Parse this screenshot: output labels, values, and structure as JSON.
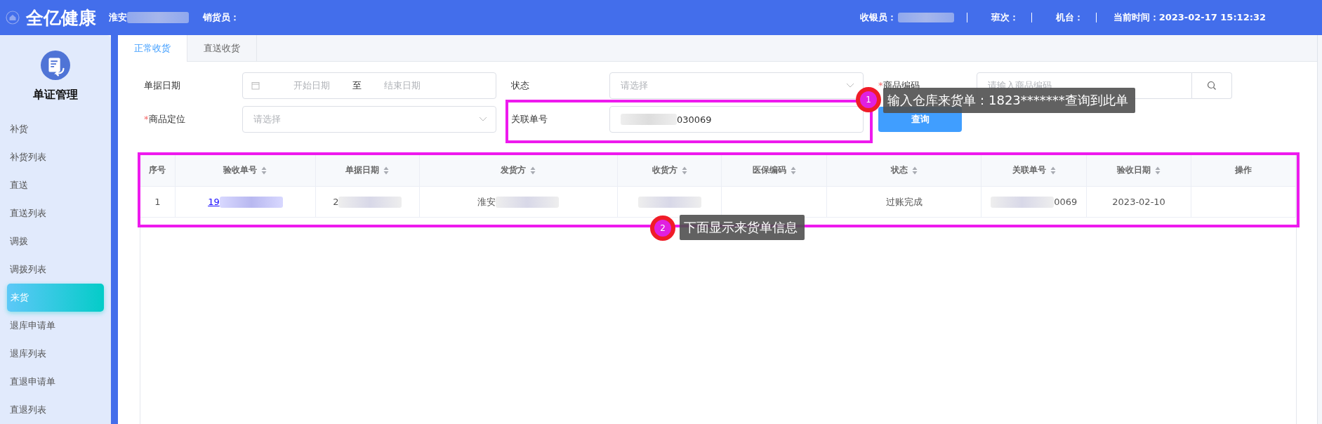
{
  "header": {
    "brand": "全亿健康",
    "store": "淮安",
    "salesperson_label": "销货员：",
    "cashier_label": "收银员：",
    "shift_label": "班次：",
    "terminal_label": "机台：",
    "time": "当前时间：2023-02-17 15:12:32"
  },
  "sidebar": {
    "title": "单证管理",
    "items": [
      {
        "label": "补货",
        "selected": false
      },
      {
        "label": "补货列表",
        "selected": false
      },
      {
        "label": "直送",
        "selected": false
      },
      {
        "label": "直送列表",
        "selected": false
      },
      {
        "label": "调拨",
        "selected": false
      },
      {
        "label": "调拨列表",
        "selected": false
      },
      {
        "label": "来货",
        "selected": true
      },
      {
        "label": "退库申请单",
        "selected": false
      },
      {
        "label": "退库列表",
        "selected": false
      },
      {
        "label": "直退申请单",
        "selected": false
      },
      {
        "label": "直退列表",
        "selected": false
      }
    ]
  },
  "tabs": [
    {
      "label": "正常收货",
      "selected": true
    },
    {
      "label": "直送收货",
      "selected": false
    }
  ],
  "form": {
    "date_label": "单据日期",
    "start_placeholder": "开始日期",
    "range_separator": "至",
    "end_placeholder": "结束日期",
    "status_label": "状态",
    "status_placeholder": "请选择",
    "code_label": "商品编码",
    "code_required_mark": "*",
    "code_placeholder": "请输入商品编码",
    "location_label": "商品定位",
    "location_required_mark": "*",
    "location_placeholder": "请选择",
    "related_label": "关联单号",
    "related_value": "030069",
    "query_button": "查询"
  },
  "table": {
    "columns": [
      {
        "label": "序号",
        "sortable": false
      },
      {
        "label": "验收单号",
        "sortable": true
      },
      {
        "label": "单据日期",
        "sortable": true
      },
      {
        "label": "发货方",
        "sortable": true
      },
      {
        "label": "收货方",
        "sortable": true
      },
      {
        "label": "医保编码",
        "sortable": true
      },
      {
        "label": "状态",
        "sortable": true
      },
      {
        "label": "关联单号",
        "sortable": true
      },
      {
        "label": "验收日期",
        "sortable": true
      },
      {
        "label": "操作",
        "sortable": false
      }
    ],
    "rows": [
      {
        "cells": [
          "1",
          "19",
          "2",
          "淮安",
          "",
          "",
          "过账完成",
          "0069",
          "2023-02-10",
          ""
        ]
      }
    ]
  },
  "annotations": [
    {
      "number": "1",
      "text": "输入仓库来货单：1823*******查询到此单"
    },
    {
      "number": "2",
      "text": "下面显示来货单信息"
    }
  ]
}
